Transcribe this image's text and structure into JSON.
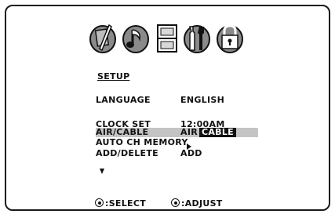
{
  "menu": {
    "title": "SETUP",
    "rows": [
      {
        "label": "LANGUAGE",
        "value": "ENGLISH"
      },
      {
        "label": "CLOCK SET",
        "value": "12:00AM"
      },
      {
        "label": "AIR/CABLE",
        "value_prefix": "AIR",
        "value_selected": "CABLE"
      },
      {
        "label": "AUTO CH MEMORY"
      },
      {
        "label": "ADD/DELETE",
        "value": "ADD"
      }
    ]
  },
  "footer": {
    "select": ":SELECT",
    "adjust": ":ADJUST"
  },
  "icons": [
    "picture-icon",
    "audio-icon",
    "timer-icon",
    "setup-tools-icon",
    "lock-icon"
  ],
  "colors": {
    "highlight": "#c4c4c4",
    "selected_bg": "#111111",
    "icon_fill": "#8a8a8a"
  }
}
